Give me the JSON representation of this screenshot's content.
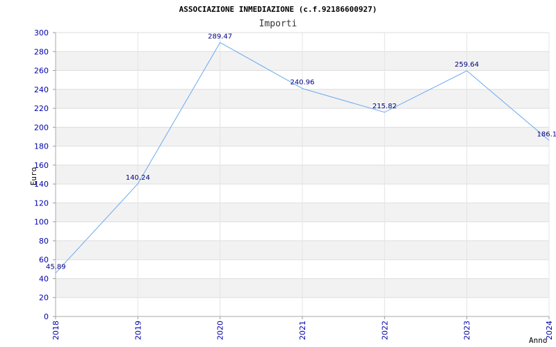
{
  "chart_data": {
    "type": "line",
    "title": "ASSOCIAZIONE INMEDIAZIONE (c.f.92186600927)",
    "subtitle": "Importi",
    "xlabel": "Anno",
    "ylabel": "Euro",
    "x": [
      "2018",
      "2019",
      "2020",
      "2021",
      "2022",
      "2023",
      "2024"
    ],
    "series": [
      {
        "values": [
          45.89,
          140.24,
          289.47,
          240.96,
          215.82,
          259.64,
          186.1
        ],
        "labels": [
          "45.89",
          "140.24",
          "289.47",
          "240.96",
          "215.82",
          "259.64",
          "186.10"
        ]
      }
    ],
    "ylim": [
      0,
      300
    ],
    "yticks": [
      0,
      20,
      40,
      60,
      80,
      100,
      120,
      140,
      160,
      180,
      200,
      220,
      240,
      260,
      280,
      300
    ],
    "grid": true,
    "colors": {
      "line": "#6aaaf0",
      "band": "#f2f2f2",
      "tick_text": "#0000aa",
      "label_text": "#000080"
    }
  }
}
